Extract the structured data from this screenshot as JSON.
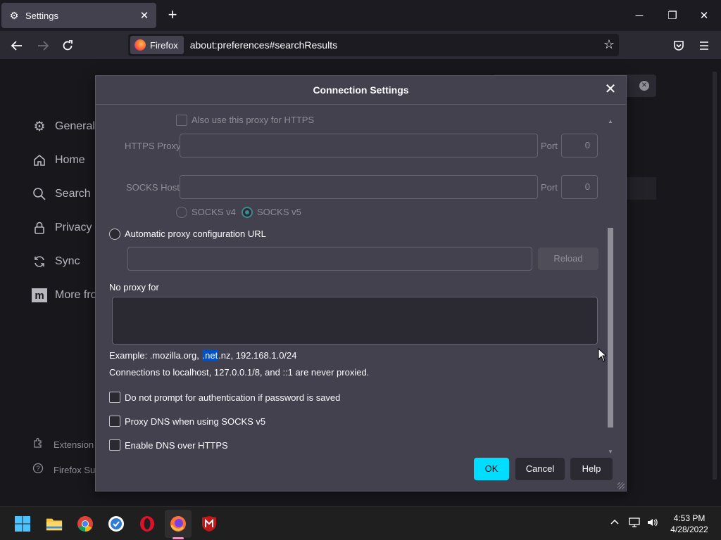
{
  "tab": {
    "title": "Settings",
    "icon": "gear-icon"
  },
  "window_controls": {
    "minimize": "─",
    "restore": "❐",
    "close": "✕"
  },
  "navbar": {
    "identity_label": "Firefox",
    "url": "about:preferences#searchResults"
  },
  "sidebar": {
    "items": [
      {
        "label": "General",
        "icon": "gear-icon"
      },
      {
        "label": "Home",
        "icon": "home-icon"
      },
      {
        "label": "Search",
        "icon": "search-icon"
      },
      {
        "label": "Privacy &",
        "icon": "lock-icon"
      },
      {
        "label": "Sync",
        "icon": "sync-icon"
      },
      {
        "label": "More fro",
        "icon": "mozilla-icon"
      }
    ],
    "footer": [
      {
        "label": "Extension",
        "icon": "puzzle-icon"
      },
      {
        "label": "Firefox Su",
        "icon": "help-icon"
      }
    ]
  },
  "dialog": {
    "title": "Connection Settings",
    "https_checkbox_label": "Also use this proxy for HTTPS",
    "https_proxy_label": "HTTPS Proxy",
    "https_port_label": "Port",
    "https_port_value": "0",
    "socks_host_label": "SOCKS Host",
    "socks_port_label": "Port",
    "socks_port_value": "0",
    "socks_v4_label": "SOCKS v4",
    "socks_v5_label": "SOCKS v5",
    "auto_proxy_label": "Automatic proxy configuration URL",
    "reload_label": "Reload",
    "no_proxy_label": "No proxy for",
    "example_prefix": "Example: .mozilla.org, ",
    "example_highlight": ".net",
    "example_suffix": ".nz, 192.168.1.0/24",
    "localhost_note": "Connections to localhost, 127.0.0.1/8, and ::1 are never proxied.",
    "no_prompt_auth_label": "Do not prompt for authentication if password is saved",
    "proxy_dns_label": "Proxy DNS when using SOCKS v5",
    "enable_doh_label": "Enable DNS over HTTPS",
    "ok_label": "OK",
    "cancel_label": "Cancel",
    "help_label": "Help"
  },
  "taskbar": {
    "apps": [
      "start-icon",
      "file-explorer-icon",
      "chrome-icon",
      "brave-icon",
      "opera-icon",
      "firefox-icon",
      "mcafee-icon"
    ],
    "time": "4:53 PM",
    "date": "4/28/2022"
  },
  "colors": {
    "accent": "#00ddff",
    "dialog_bg": "#42414d",
    "page_bg": "#1c1b22"
  }
}
